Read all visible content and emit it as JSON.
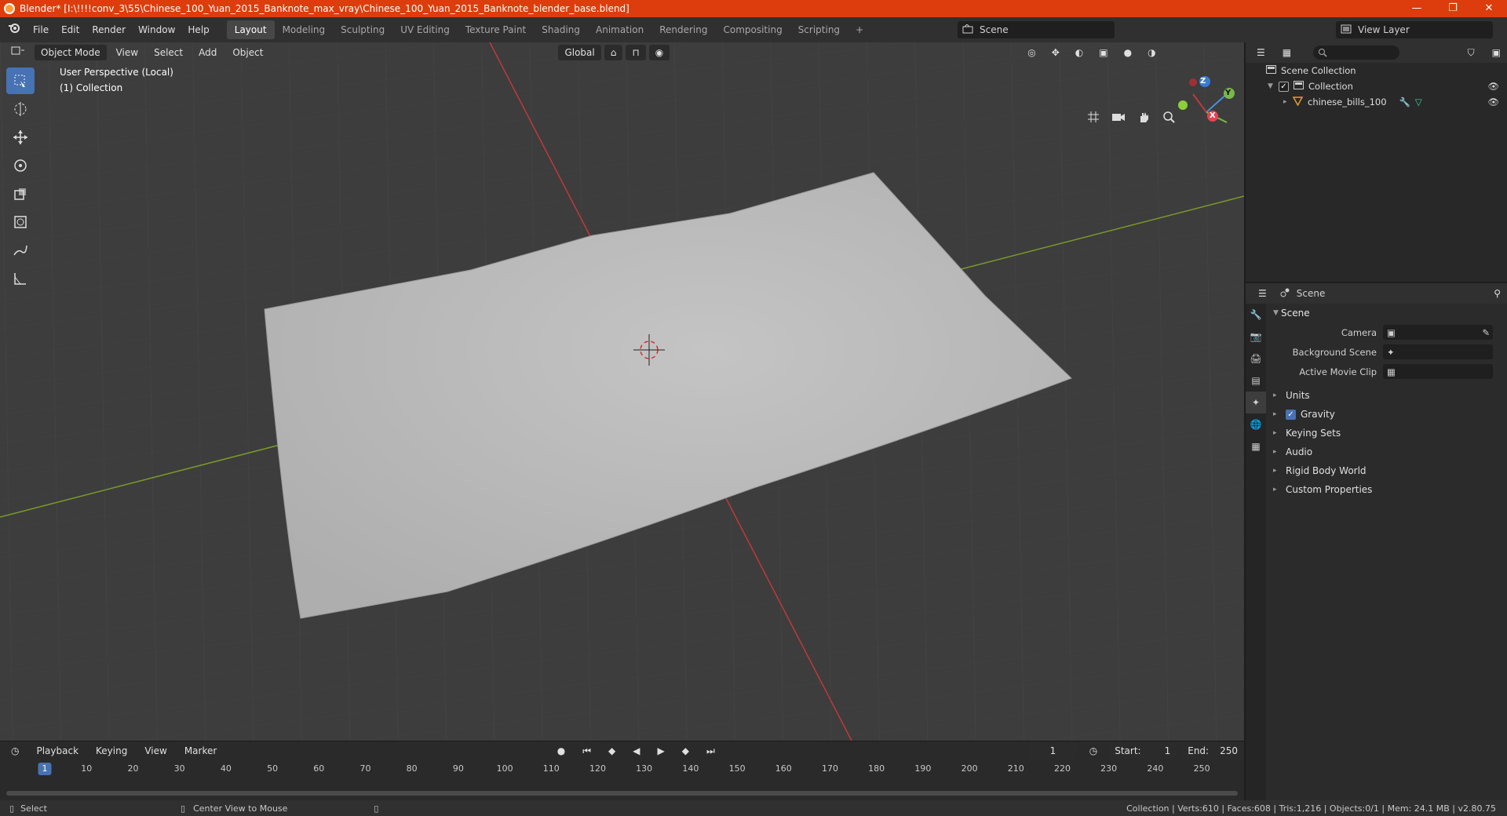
{
  "window": {
    "title": "Blender* [I:\\!!!!conv_3\\55\\Chinese_100_Yuan_2015_Banknote_max_vray\\Chinese_100_Yuan_2015_Banknote_blender_base.blend]",
    "controls": [
      "—",
      "❐",
      "✕"
    ]
  },
  "menu": [
    "File",
    "Edit",
    "Render",
    "Window",
    "Help"
  ],
  "workspaces": [
    "Layout",
    "Modeling",
    "Sculpting",
    "UV Editing",
    "Texture Paint",
    "Shading",
    "Animation",
    "Rendering",
    "Compositing",
    "Scripting"
  ],
  "active_workspace": "Layout",
  "add_workspace": "+",
  "scene_name": "Scene",
  "view_layer": "View Layer",
  "viewport": {
    "mode": "Object Mode",
    "menus": [
      "View",
      "Select",
      "Add",
      "Object"
    ],
    "orientation": "Global",
    "info_line1": "User Perspective (Local)",
    "info_line2": "(1) Collection",
    "gizmo_axes": [
      "Z",
      "Y",
      "X"
    ]
  },
  "tools": [
    "select-box",
    "cursor",
    "move",
    "rotate",
    "scale",
    "transform",
    "annotate",
    "measure"
  ],
  "timeline": {
    "menus": [
      "Playback",
      "Keying",
      "View",
      "Marker"
    ],
    "current_frame": "1",
    "start_label": "Start:",
    "start": "1",
    "end_label": "End:",
    "end": "250",
    "ticks": [
      "10",
      "20",
      "30",
      "40",
      "50",
      "60",
      "70",
      "80",
      "90",
      "100",
      "110",
      "120",
      "130",
      "140",
      "150",
      "160",
      "170",
      "180",
      "190",
      "200",
      "210",
      "220",
      "230",
      "240",
      "250"
    ]
  },
  "outliner": {
    "root": "Scene Collection",
    "collection": "Collection",
    "object": "chinese_bills_100"
  },
  "properties": {
    "context": "Scene",
    "panel": "Scene",
    "fields": [
      {
        "label": "Camera"
      },
      {
        "label": "Background Scene"
      },
      {
        "label": "Active Movie Clip"
      }
    ],
    "subpanels": [
      "Units",
      "Gravity",
      "Keying Sets",
      "Audio",
      "Rigid Body World",
      "Custom Properties"
    ]
  },
  "status": {
    "left_action": "Select",
    "mid_action": "Center View to Mouse",
    "stats": "Collection | Verts:610 | Faces:608 | Tris:1,216 | Objects:0/1 | Mem: 24.1 MB | v2.80.75"
  },
  "colors": {
    "titlebar": "#dd3d0d",
    "accent": "#4772b3",
    "x_axis": "#c0393b",
    "y_axis": "#7a9a2a",
    "mesh": "#b9b9b9"
  }
}
